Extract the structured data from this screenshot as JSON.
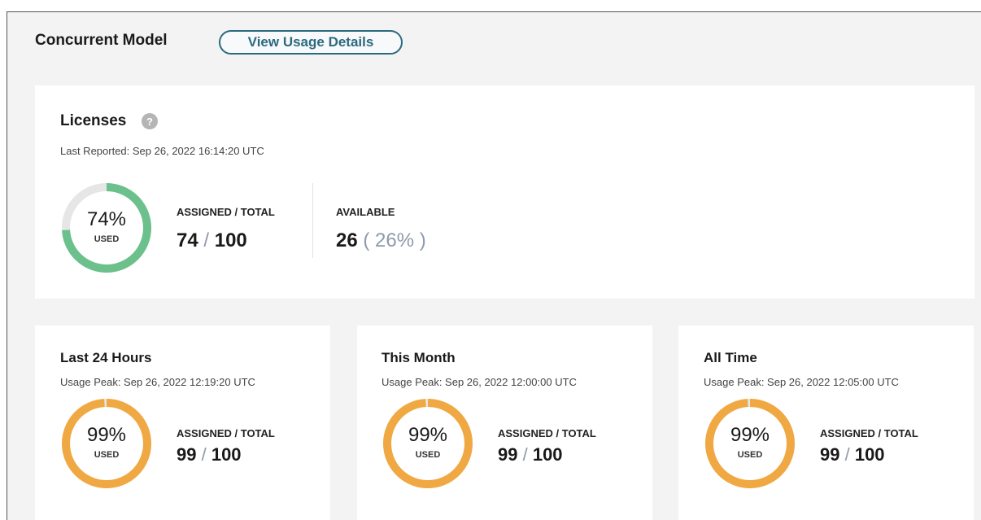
{
  "header": {
    "title": "Concurrent Model",
    "usage_button": "View Usage Details"
  },
  "licenses": {
    "title": "Licenses",
    "help_glyph": "?",
    "last_reported": "Last Reported: Sep 26, 2022 16:14:20 UTC",
    "used_fraction": 0.74,
    "used_pct_text": "74%",
    "used_label": "USED",
    "assigned_label": "ASSIGNED / TOTAL",
    "assigned": "74",
    "slash": " / ",
    "total": "100",
    "available_label": "AVAILABLE",
    "available": "26",
    "available_pct": " ( 26% )"
  },
  "periods": [
    {
      "title": "Last 24 Hours",
      "peak": "Usage Peak: Sep 26, 2022 12:19:20 UTC",
      "used_fraction": 0.99,
      "used_pct_text": "99%",
      "used_label": "USED",
      "assigned_label": "ASSIGNED / TOTAL",
      "assigned": "99",
      "slash": " / ",
      "total": "100"
    },
    {
      "title": "This Month",
      "peak": "Usage Peak: Sep 26, 2022 12:00:00 UTC",
      "used_fraction": 0.99,
      "used_pct_text": "99%",
      "used_label": "USED",
      "assigned_label": "ASSIGNED / TOTAL",
      "assigned": "99",
      "slash": " / ",
      "total": "100"
    },
    {
      "title": "All Time",
      "peak": "Usage Peak: Sep 26, 2022 12:05:00 UTC",
      "used_fraction": 0.99,
      "used_pct_text": "99%",
      "used_label": "USED",
      "assigned_label": "ASSIGNED / TOTAL",
      "assigned": "99",
      "slash": " / ",
      "total": "100"
    }
  ],
  "colors": {
    "green": "#6cc08b",
    "orange": "#f0a842",
    "track": "#e6e6e6",
    "accent": "#2b6a7f"
  }
}
